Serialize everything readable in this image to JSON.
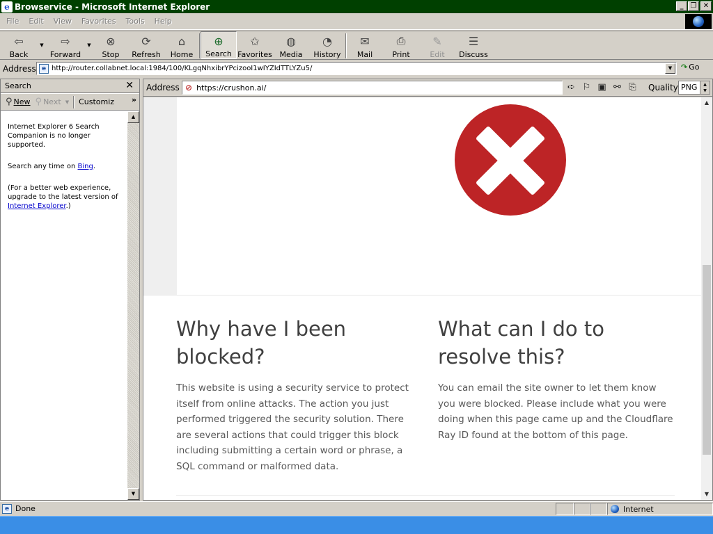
{
  "window": {
    "title": "Browservice - Microsoft Internet Explorer",
    "minimize": "_",
    "maximize": "❐",
    "close": "✕"
  },
  "menu": [
    "File",
    "Edit",
    "View",
    "Favorites",
    "Tools",
    "Help"
  ],
  "toolbar": {
    "back": "Back",
    "forward": "Forward",
    "stop": "Stop",
    "refresh": "Refresh",
    "home": "Home",
    "search": "Search",
    "favorites": "Favorites",
    "media": "Media",
    "history": "History",
    "mail": "Mail",
    "print": "Print",
    "edit": "Edit",
    "discuss": "Discuss"
  },
  "address": {
    "label": "Address",
    "url": "http://router.collabnet.local:1984/100/KLgqNhxibrYPcizooI1wIYZIdTTLYZu5/",
    "go": "Go"
  },
  "search_pane": {
    "title": "Search",
    "close": "✕",
    "new": "New",
    "next": "Next",
    "customize": "Customiz",
    "more": "»",
    "msg1": "Internet Explorer 6 Search Companion is no longer supported.",
    "msg2_prefix": "Search any time on ",
    "msg2_link": "Bing",
    "msg2_suffix": ".",
    "msg3_prefix": "(For a better web experience, upgrade to the latest version of ",
    "msg3_link": "Internet Explorer",
    "msg3_suffix": ".)"
  },
  "inner_browser": {
    "address_label": "Address",
    "url": "https://crushon.ai/",
    "quality_label": "Quality",
    "quality_value": "PNG"
  },
  "page": {
    "left_heading": "Why have I been blocked?",
    "left_text": "This website is using a security service to protect itself from online attacks. The action you just performed triggered the security solution. There are several actions that could trigger this block including submitting a certain word or phrase, a SQL command or malformed data.",
    "right_heading": "What can I do to resolve this?",
    "right_text": "You can email the site owner to let them know you were blocked. Please include what you were doing when this page came up and the Cloudflare Ray ID found at the bottom of this page.",
    "error_color": "#bd2426"
  },
  "status": {
    "text": "Done",
    "zone": "Internet"
  }
}
